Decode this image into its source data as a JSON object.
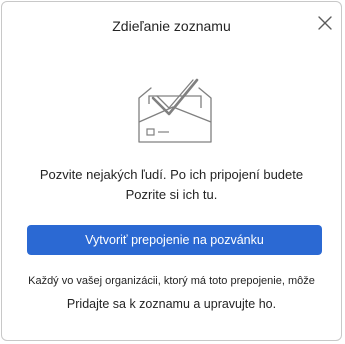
{
  "dialog": {
    "title": "Zdieľanie zoznamu",
    "close_icon": "close-icon",
    "illustration_icon": "envelope-checkmark-icon",
    "message_line1": "Pozvite nejakých ľudí. Po ich pripojení budete",
    "message_line2": "Pozrite si ich tu.",
    "create_button_label": "Vytvoriť prepojenie na pozvánku",
    "info_line1": "Každý vo vašej organizácii, ktorý má toto prepojenie, môže",
    "info_line2": "Pridajte sa k zoznamu a upravujte ho."
  },
  "colors": {
    "accent": "#2b69d3",
    "text": "#242424",
    "illustration": "#808080",
    "border": "#c8c8c8"
  }
}
